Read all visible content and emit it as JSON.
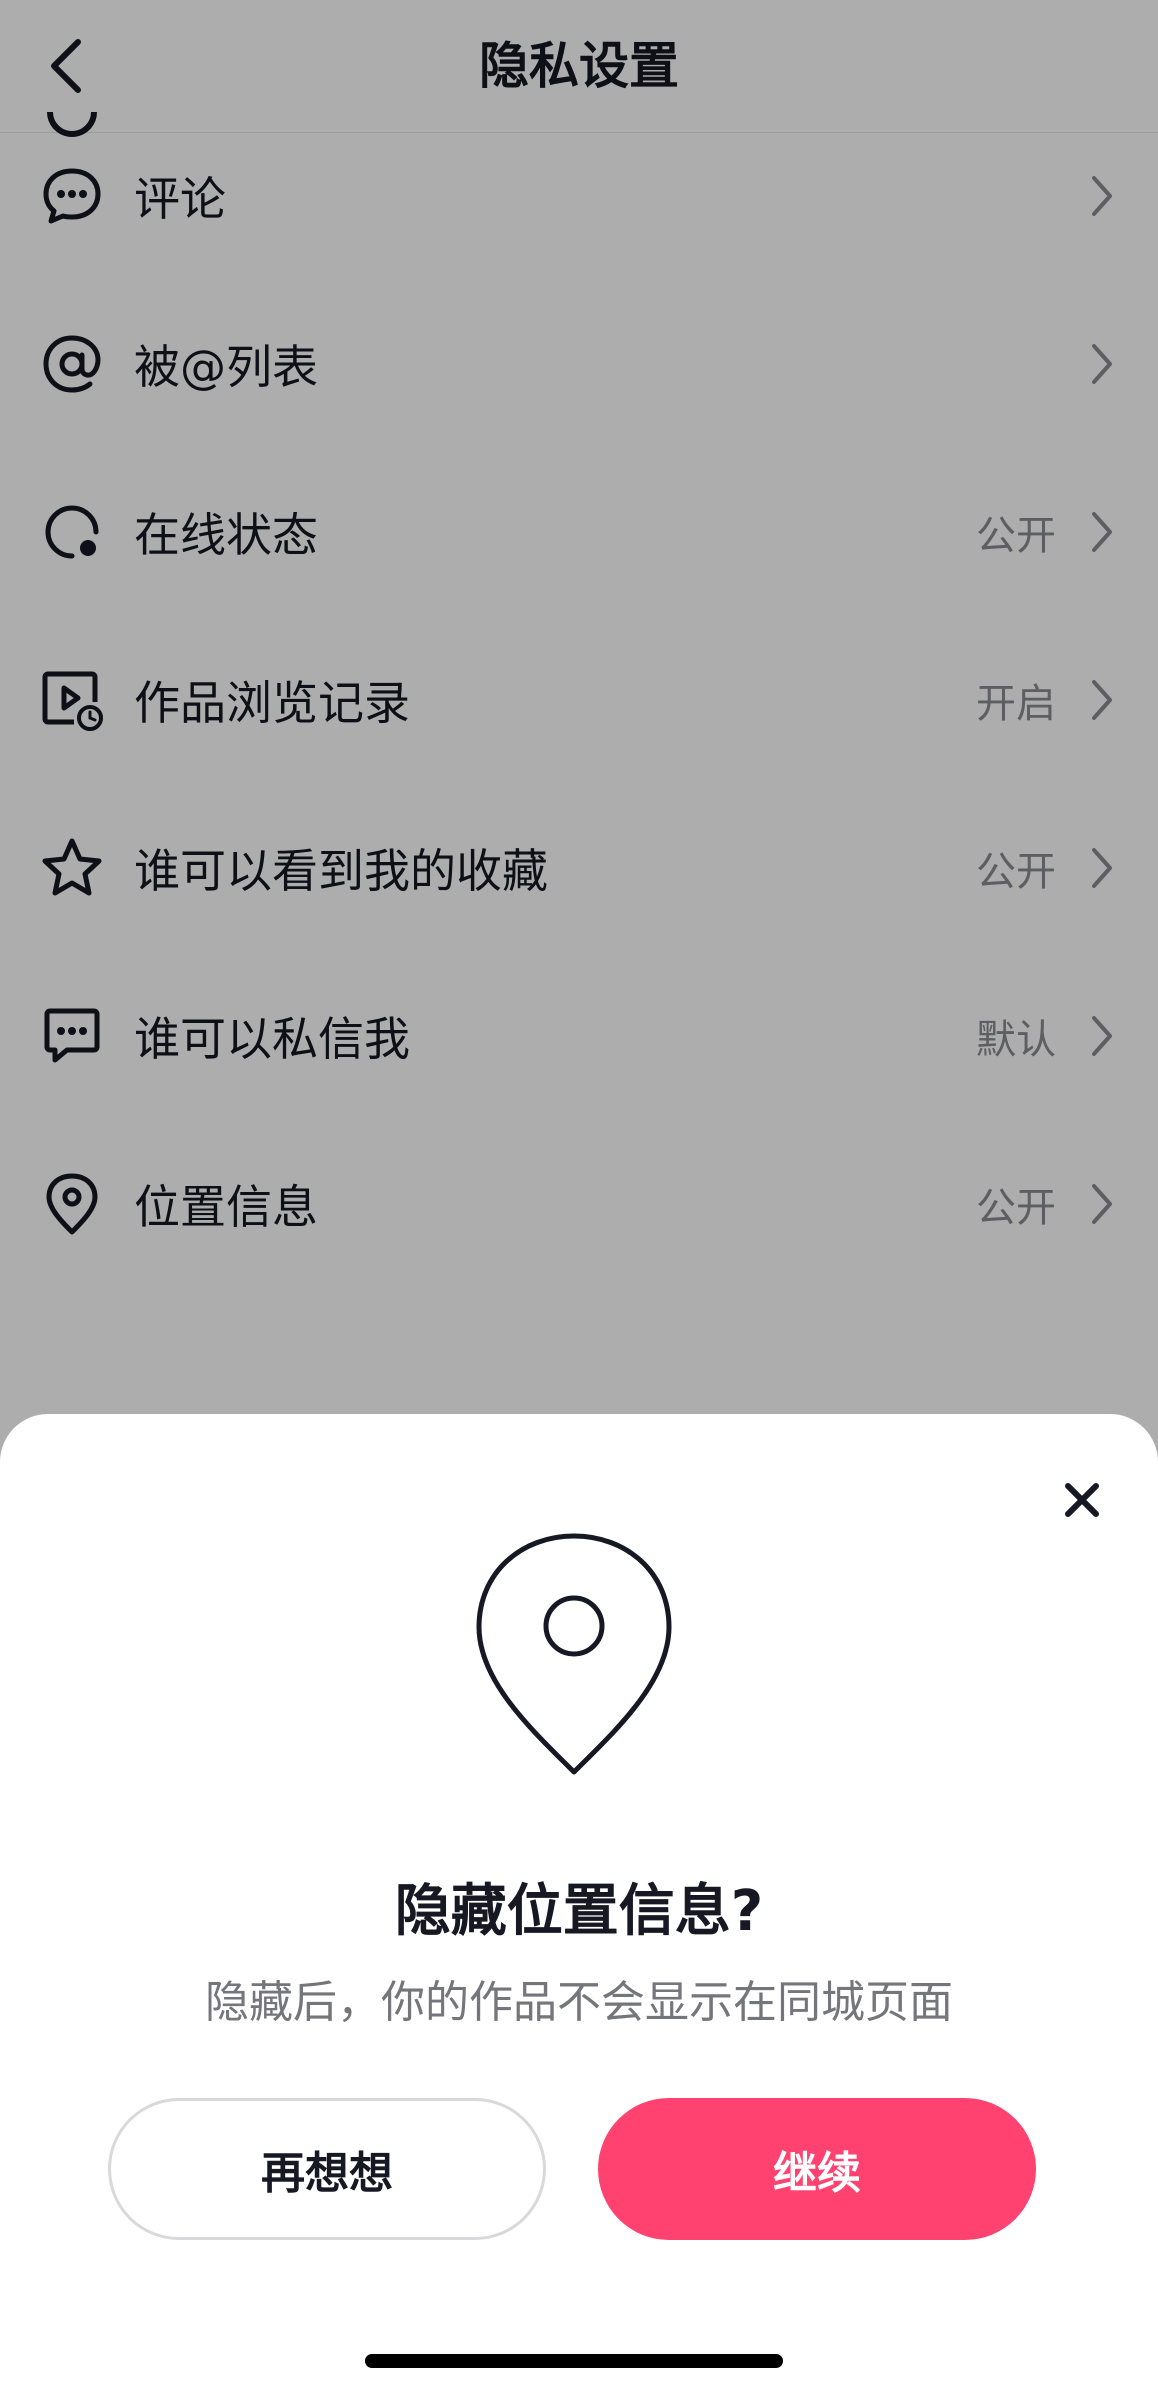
{
  "header": {
    "title": "隐私设置"
  },
  "settings": [
    {
      "icon": "comment-icon",
      "label": "评论",
      "value": ""
    },
    {
      "icon": "at-mention-icon",
      "label": "被@列表",
      "value": ""
    },
    {
      "icon": "online-status-icon",
      "label": "在线状态",
      "value": "公开"
    },
    {
      "icon": "play-history-icon",
      "label": "作品浏览记录",
      "value": "开启"
    },
    {
      "icon": "star-icon",
      "label": "谁可以看到我的收藏",
      "value": "公开"
    },
    {
      "icon": "message-icon",
      "label": "谁可以私信我",
      "value": "默认"
    },
    {
      "icon": "location-pin-icon",
      "label": "位置信息",
      "value": "公开"
    }
  ],
  "dialog": {
    "title": "隐藏位置信息?",
    "description": "隐藏后，你的作品不会显示在同城页面",
    "cancel_label": "再想想",
    "confirm_label": "继续",
    "confirm_color": "#ff4270"
  }
}
